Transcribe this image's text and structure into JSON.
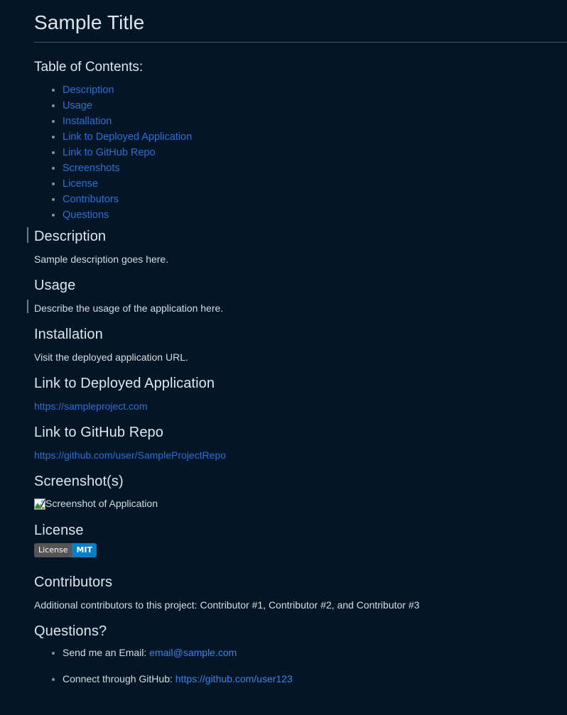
{
  "document": {
    "title": "Sample Title",
    "toc_heading": "Table of Contents:",
    "toc_items": [
      {
        "label": "Description"
      },
      {
        "label": "Usage"
      },
      {
        "label": "Installation"
      },
      {
        "label": "Link to Deployed Application"
      },
      {
        "label": "Link to GitHub Repo"
      },
      {
        "label": "Screenshots"
      },
      {
        "label": "License"
      },
      {
        "label": "Contributors"
      },
      {
        "label": "Questions"
      }
    ],
    "sections": {
      "description": {
        "heading": "Description",
        "body": "Sample description goes here."
      },
      "usage": {
        "heading": "Usage",
        "body": "Describe the usage of the application here."
      },
      "installation": {
        "heading": "Installation",
        "body": "Visit the deployed application URL."
      },
      "deployed_link": {
        "heading": "Link to Deployed Application",
        "url_text": "https://sampleproject.com"
      },
      "github_link": {
        "heading": "Link to GitHub Repo",
        "url_text": "https://github.com/user/SampleProjectRepo"
      },
      "screenshots": {
        "heading": "Screenshot(s)",
        "image_alt_text": "Screenshot of Application",
        "image_icon": "broken-image-icon"
      },
      "license": {
        "heading": "License",
        "badge_label": "License",
        "badge_value": "MIT"
      },
      "contributors": {
        "heading": "Contributors",
        "body": "Additional contributors to this project: Contributor #1, Contributor #2, and Contributor #3"
      },
      "questions": {
        "heading": "Questions?",
        "items": [
          {
            "prefix": "Send me an Email: ",
            "link_text": "email@sample.com"
          },
          {
            "prefix": "Connect through GitHub: ",
            "link_text": "https://github.com/user123"
          }
        ]
      }
    },
    "colors": {
      "background": "#041626",
      "text": "#d6dce3",
      "link": "#2d6fd6",
      "link_light": "#3e84e8",
      "rule": "#42525e",
      "caret": "#6f7c88",
      "badge_left": "#555555",
      "badge_right": "#047ec6"
    }
  }
}
